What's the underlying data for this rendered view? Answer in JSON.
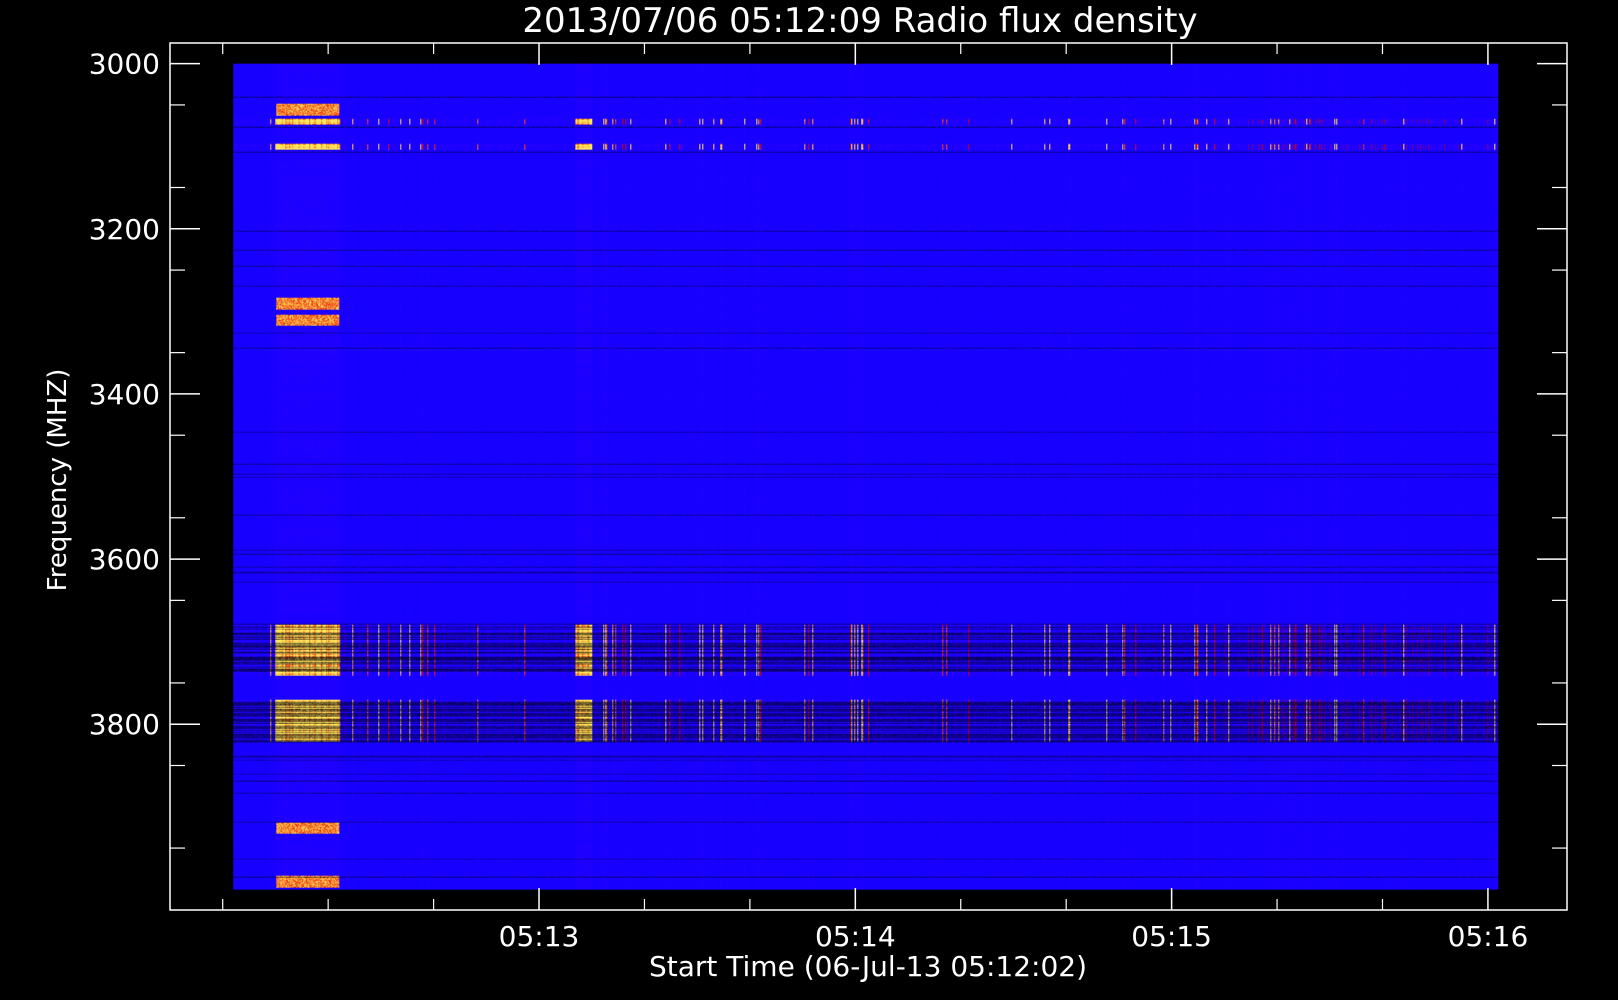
{
  "chart_data": {
    "type": "heatmap",
    "title": "2013/07/06 05:12:09 Radio flux density",
    "xlabel": "Start Time (06-Jul-13 05:12:02)",
    "ylabel": "Frequency (MHZ)",
    "x_ticks": [
      {
        "label": "05:13",
        "seconds": 58
      },
      {
        "label": "05:14",
        "seconds": 118
      },
      {
        "label": "05:15",
        "seconds": 178
      },
      {
        "label": "05:16",
        "seconds": 238
      }
    ],
    "x_range_seconds": [
      -12,
      253
    ],
    "data_x_range_seconds": [
      0,
      240
    ],
    "y_ticks": [
      3000,
      3200,
      3400,
      3600,
      3800
    ],
    "y_range": [
      2975,
      4025
    ],
    "data_y_range": [
      3000,
      4000
    ],
    "y_inverted": true,
    "colors": {
      "background": "#000000",
      "axis": "#ffffff",
      "low": "#0000ff",
      "mid": "#cc0000",
      "high": "#ffff66"
    },
    "features": {
      "persistent_bands_mhz": [
        3070,
        3100
      ],
      "strong_band_ranges_mhz": [
        [
          3680,
          3740
        ],
        [
          3770,
          3820
        ]
      ],
      "burst_columns_seconds": [
        [
          8,
          20
        ],
        [
          65,
          68
        ]
      ],
      "early_bands_mhz": [
        3055,
        3290,
        3310,
        3925,
        3990
      ]
    }
  }
}
